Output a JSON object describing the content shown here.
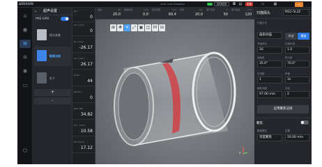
{
  "topbar": {
    "logo": "ADDSION",
    "app_title": "sectr scan template",
    "status_btn": "实时检测",
    "sound_btn": "中奖",
    "params": [
      {
        "label": "增益",
        "unit": "dB",
        "value": "20.0"
      },
      {
        "label": "起始位置",
        "unit": "mm",
        "value": "0.0"
      },
      {
        "label": "显示范围",
        "unit": "mm",
        "value": "69.4"
      },
      {
        "label": "扫查",
        "unit": "mm",
        "value": "20.0"
      },
      {
        "label": "闸门位置",
        "unit": "%",
        "value": "50"
      },
      {
        "label": "闸门宽度",
        "unit": "mm",
        "value": "120"
      }
    ]
  },
  "left_panel": {
    "title": "超声设置",
    "back": "‹",
    "probe_name": "PAE-GP0",
    "tiles": [
      {
        "label": "探头参数",
        "active": false
      },
      {
        "label": "聚焦法则",
        "active": true
      },
      {
        "label": "补丁",
        "active": false
      }
    ],
    "plus": "+",
    "minus": "-"
  },
  "data_column": {
    "cells": [
      {
        "label": "PA/°",
        "value": "0"
      },
      {
        "label": "DA^(mm)",
        "value": "0"
      },
      {
        "label": "PA^(mm)",
        "value": "-26.17"
      },
      {
        "label": "DA^(mm)",
        "value": "26.17"
      },
      {
        "label": "Scale",
        "value": "44"
      },
      {
        "label": "Rbeam",
        "value": "0"
      },
      {
        "label": "Rpk (dB)",
        "value": "34.82"
      },
      {
        "label": "Ti=.. (mm)",
        "value": "10.58"
      },
      {
        "label": "Pin=(mm)",
        "value": "17.12"
      }
    ]
  },
  "viewport_tools": [
    "⊞",
    "✥",
    "⌖",
    "⤢",
    "▣",
    "◫",
    "M",
    "⊟"
  ],
  "axis_indicator": "z",
  "right_panel": {
    "title": "扫描探头",
    "model": "M31-5L32",
    "mode_label": "扫描方式",
    "mode_value": "扇形扫描",
    "seg1": "纵波",
    "seg2": "横波",
    "fields": [
      {
        "label": "开始阵元",
        "value": "16"
      },
      {
        "label": "扫描步进",
        "value": "1.0"
      },
      {
        "label": "起始角",
        "value": "35.0°"
      },
      {
        "label": "终止角",
        "value": "70.0°"
      },
      {
        "label": "步进角",
        "value": "1"
      },
      {
        "label": "声速",
        "value": "3s"
      },
      {
        "label": "聚焦深度",
        "value": "97.00 mm"
      },
      {
        "label": "孔径",
        "value": "2"
      }
    ],
    "apply_btn": "应用聚焦法则",
    "section2_title": "聚焦",
    "focus_mode_label": "聚焦模式",
    "focus_mode_value": "深度聚焦",
    "focus_pos_label": "位置",
    "focus_pos_value": "20.00 mm"
  },
  "colors": {
    "accent": "#2e7ae6",
    "record": "#c8322c",
    "warn": "#e9852a",
    "switch": "#32c24d"
  }
}
